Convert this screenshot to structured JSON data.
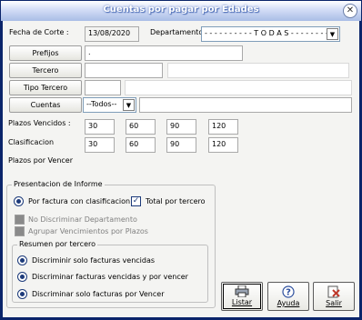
{
  "window": {
    "title": "Cuentas por pagar por Edades",
    "close_glyph": "✕"
  },
  "header": {
    "fecha_label": "Fecha de Corte :",
    "fecha_value": "13/08/2020",
    "departamento_label": "Departamento:",
    "departamento_value": "- - - - - - - - - -  T O D A S  - - - - - - - - - -"
  },
  "buttons": {
    "prefijos": "Prefijos",
    "tercero": "Tercero",
    "tipo_tercero": "Tipo Tercero",
    "cuentas": "Cuentas"
  },
  "fields": {
    "prefijos_value": ".",
    "cuentas_select": "--Todos--"
  },
  "plazos": {
    "vencidos_label": "Plazos Vencidos :",
    "vencidos": [
      "30",
      "60",
      "90",
      "120"
    ],
    "clasificacion_label": "Clasificacion",
    "clasificacion": [
      "30",
      "60",
      "90",
      "120"
    ],
    "por_vencer_label": "Plazos por Vencer"
  },
  "presentacion": {
    "title": "Presentacion de Informe",
    "por_factura": "Por factura con clasificacion",
    "total_tercero": "Total por tercero",
    "no_discriminar": "No Discriminar Departamento",
    "agrupar": "Agrupar Vencimientos por Plazos"
  },
  "resumen": {
    "title": "Resumen por tercero",
    "options": [
      "Discriminir solo facturas vencidas",
      "Discriminar facturas vencidas y por vencer",
      "Discriminar solo facturas por Vencer"
    ]
  },
  "actions": {
    "listar": "Listar",
    "ayuda": "Ayuda",
    "salir": "Salir"
  },
  "colors": {
    "titlebar": "#a9bde6",
    "frame": "#0a246a",
    "face": "#f4f4f2",
    "salir_icon": "#c0392b"
  }
}
